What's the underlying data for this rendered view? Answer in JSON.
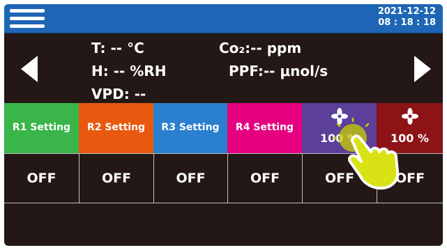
{
  "header": {
    "date": "2021-12-12",
    "time": "08 : 18 : 18"
  },
  "sensors": {
    "temperature": "T: --  °C",
    "humidity": "H: --  %RH",
    "vpd": "VPD: --",
    "co2": "Co₂:-- ppm",
    "ppf": "PPF:-- μnol/s"
  },
  "relays": [
    {
      "label": "R1 Setting",
      "color": "#39b54a"
    },
    {
      "label": "R2 Setting",
      "color": "#e8590f"
    },
    {
      "label": "R3 Setting",
      "color": "#2a7fcf"
    },
    {
      "label": "R4 Setting",
      "color": "#e4007f"
    }
  ],
  "fans": [
    {
      "percent": "100 %",
      "color": "#5b3f9a",
      "icon": "fan-icon"
    },
    {
      "percent": "100 %",
      "color": "#8c1416",
      "icon": "fan-icon"
    }
  ],
  "states": [
    "OFF",
    "OFF",
    "OFF",
    "OFF",
    "OFF",
    "OFF"
  ],
  "colors": {
    "background": "#231816",
    "topbar": "#1e66b5"
  },
  "icons": [
    "menu-icon",
    "arrow-left-icon",
    "arrow-right-icon",
    "fan-icon",
    "pointing-hand-icon"
  ]
}
